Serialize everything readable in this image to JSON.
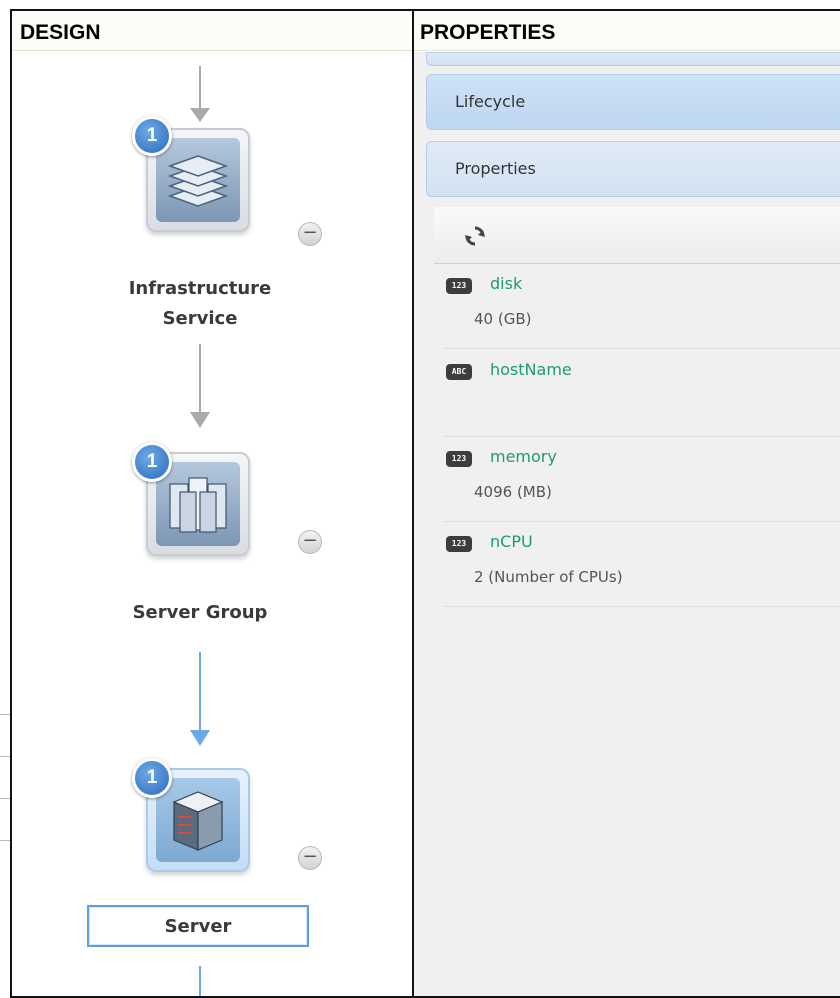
{
  "headers": {
    "design": "DESIGN",
    "properties": "PROPERTIES"
  },
  "nodes": [
    {
      "badge": "1",
      "label_line1": "Infrastructure",
      "label_line2": "Service",
      "icon": "layers-stack-icon",
      "collapse": "−"
    },
    {
      "badge": "1",
      "label": "Server Group",
      "icon": "server-cluster-icon",
      "collapse": "−"
    },
    {
      "badge": "1",
      "label": "Server",
      "icon": "server-rack-icon",
      "collapse": "−",
      "selected": true
    }
  ],
  "accordion": [
    {
      "label": ""
    },
    {
      "label": "Lifecycle"
    },
    {
      "label": "Properties"
    }
  ],
  "toolbar": {
    "icon": "refresh-icon"
  },
  "properties": [
    {
      "type": "123",
      "name": "disk",
      "value": "40 (GB)"
    },
    {
      "type": "ABC",
      "name": "hostName",
      "value": ""
    },
    {
      "type": "123",
      "name": "memory",
      "value": "4096 (MB)"
    },
    {
      "type": "123",
      "name": "nCPU",
      "value": "2 (Number of CPUs)"
    }
  ],
  "colors": {
    "accent": "#5ea0de",
    "property_name": "#1f9b6f",
    "badge": "#2a6cbc",
    "connector_gray": "#aaaaaa",
    "connector_active": "#6aa8e6"
  }
}
